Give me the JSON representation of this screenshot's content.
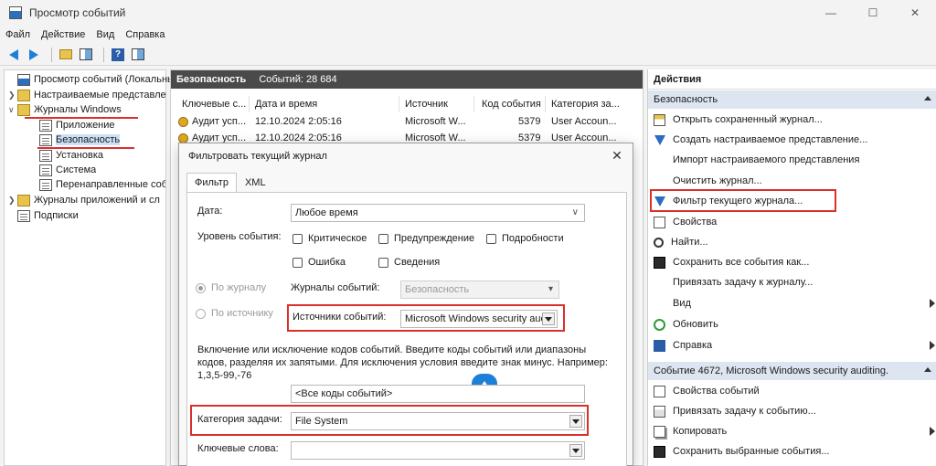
{
  "window": {
    "title": "Просмотр событий"
  },
  "menu": [
    "Файл",
    "Действие",
    "Вид",
    "Справка"
  ],
  "tree": {
    "root": "Просмотр событий (Локальнь",
    "custom_views": "Настраиваемые представле",
    "windows_logs": "Журналы Windows",
    "application": "Приложение",
    "security": "Безопасность",
    "setup": "Установка",
    "system": "Система",
    "forwarded": "Перенаправленные собь",
    "app_logs": "Журналы приложений и сл",
    "subscriptions": "Подписки"
  },
  "middle": {
    "title": "Безопасность",
    "count": "Событий: 28 684",
    "columns": [
      "Ключевые с...",
      "Дата и время",
      "Источник",
      "Код события",
      "Категория за..."
    ],
    "rows": [
      {
        "keywords": "Аудит усп...",
        "datetime": "12.10.2024 2:05:16",
        "source": "Microsoft W...",
        "event_id": "5379",
        "category": "User Accoun..."
      },
      {
        "keywords": "Аудит усп...",
        "datetime": "12.10.2024 2:05:16",
        "source": "Microsoft W...",
        "event_id": "5379",
        "category": "User Accoun..."
      }
    ]
  },
  "dialog": {
    "title": "Фильтровать текущий журнал",
    "tab_filter": "Фильтр",
    "tab_xml": "XML",
    "date_label": "Дата:",
    "date_value": "Любое время",
    "level_label": "Уровень события:",
    "levels": [
      "Критическое",
      "Предупреждение",
      "Подробности",
      "Ошибка",
      "Сведения"
    ],
    "by_log": "По журналу",
    "by_source": "По источнику",
    "event_logs_label": "Журналы событий:",
    "event_logs_value": "Безопасность",
    "sources_label": "Источники событий:",
    "sources_value": "Microsoft Windows security auc",
    "help_text": "Включение или исключение кодов событий. Введите коды событий или диапазоны кодов, разделяя их запятыми. Для исключения условия введите знак минус. Например: 1,3,5-99,-76",
    "event_ids_value": "<Все коды событий>",
    "task_category_label": "Категория задачи:",
    "task_category_value": "File System",
    "keywords_label": "Ключевые слова:",
    "keywords_value": ""
  },
  "actions": {
    "title": "Действия",
    "section1": "Безопасность",
    "items1": [
      "Открыть сохраненный журнал...",
      "Создать настраиваемое представление...",
      "Импорт настраиваемого представления",
      "Очистить журнал...",
      "Фильтр текущего журнала...",
      "Свойства",
      "Найти...",
      "Сохранить все события как...",
      "Привязать задачу к журналу...",
      "Вид",
      "Обновить",
      "Справка"
    ],
    "section2": "Событие 4672, Microsoft Windows security auditing.",
    "items2": [
      "Свойства событий",
      "Привязать задачу к событию...",
      "Копировать",
      "Сохранить выбранные события..."
    ]
  },
  "colors": {
    "accent": "#1e7fd8",
    "highlight_red": "#d9302c",
    "header_dark": "#4a4a4a",
    "section_bg": "#dde6f0"
  }
}
